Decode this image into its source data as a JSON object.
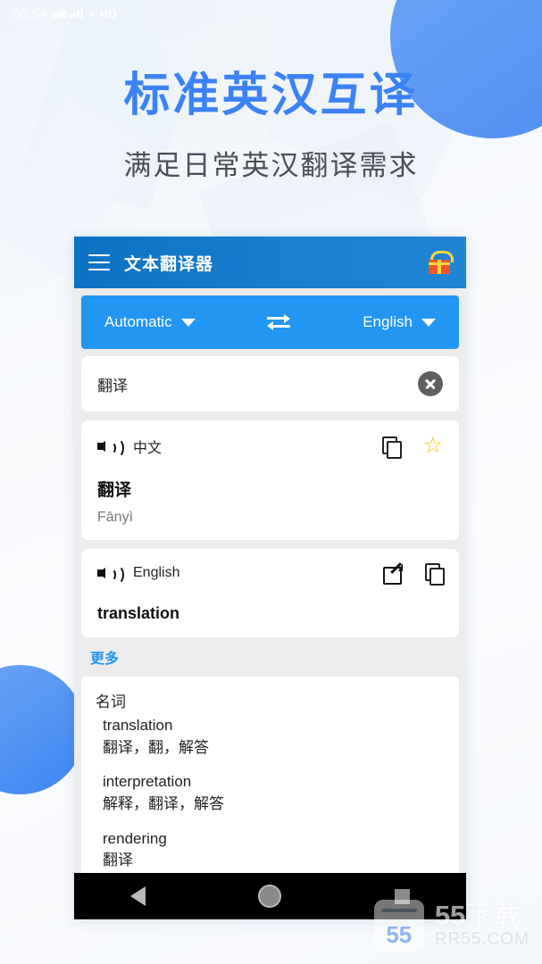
{
  "status_bar": {
    "time": "08:54",
    "network_label": "HD",
    "signal_icon": "signal-bars-icon",
    "wifi_icon": "wifi-icon"
  },
  "promo": {
    "headline": "标准英汉互译",
    "subheadline": "满足日常英汉翻译需求",
    "headline_color": "#3b82f6",
    "subheadline_color": "#4a4f57"
  },
  "app": {
    "appbar": {
      "title": "文本翻译器",
      "menu_icon": "hamburger-menu-icon",
      "gift_icon": "gift-icon",
      "bg_color": "#1a7fd0"
    },
    "language_bar": {
      "source_language": "Automatic",
      "target_language": "English",
      "swap_icon": "swap-arrows-icon",
      "bg_color": "#2196f3"
    },
    "input": {
      "value": "翻译",
      "clear_icon": "clear-circle-icon"
    },
    "source_result": {
      "language_label": "中文",
      "speaker_icon": "speaker-icon",
      "copy_icon": "copy-icon",
      "favorite_icon": "star-outline-icon",
      "favorite_color": "#f5c518",
      "text": "翻译",
      "pronunciation": "Fānyì"
    },
    "target_result": {
      "language_label": "English",
      "speaker_icon": "speaker-icon",
      "share_icon": "share-external-icon",
      "copy_icon": "copy-icon",
      "text": "translation"
    },
    "more_link": {
      "label": "更多",
      "color": "#2196f3"
    },
    "dictionary": {
      "part_of_speech": "名词",
      "entries": [
        {
          "word": "translation",
          "meanings": "翻译，翻，解答"
        },
        {
          "word": "interpretation",
          "meanings": "解释，翻译，解答"
        },
        {
          "word": "rendering",
          "meanings": "翻译"
        }
      ]
    },
    "navbar": {
      "back_icon": "back-triangle-icon",
      "home_icon": "home-circle-icon",
      "recents_icon": "recents-square-icon"
    }
  },
  "watermark": {
    "logo_text": "55",
    "title": "55下载",
    "url": "RR55.COM"
  }
}
